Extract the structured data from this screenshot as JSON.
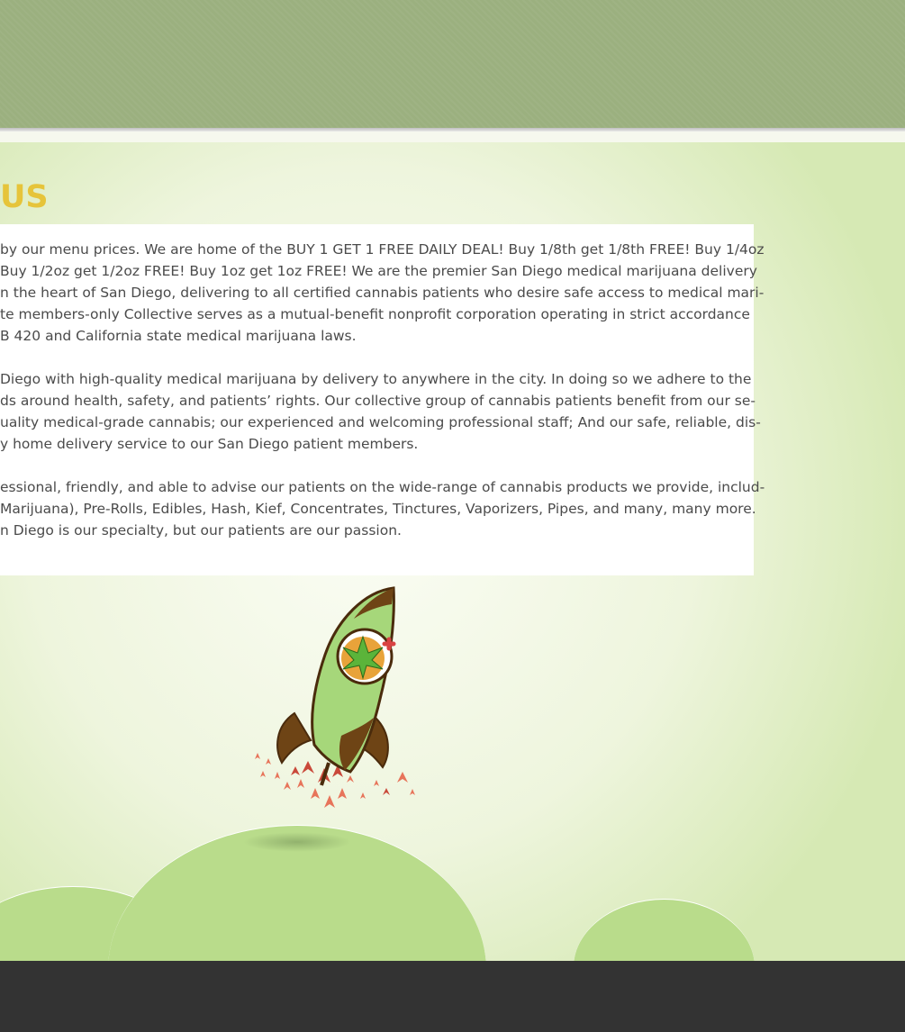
{
  "main": {
    "heading": "US",
    "paragraphs": [
      {
        "lines": [
          "by our menu prices. We are home of the BUY 1 GET 1 FREE DAILY DEAL! Buy 1/8th get 1/8th FREE! Buy 1/4oz",
          "Buy 1/2oz get 1/2oz FREE! Buy 1oz get 1oz FREE! We are the premier San Diego medical marijuana delivery",
          "n the heart of San Diego, delivering to all certified cannabis patients who desire safe access to medical mari-",
          "te members-only Collective serves as a mutual-benefit nonprofit corporation operating in strict accordance",
          "B 420 and California state medical marijuana laws."
        ]
      },
      {
        "lines": [
          "Diego with high-quality medical marijuana by delivery to anywhere in the city. In doing so we adhere to the",
          "ds around health, safety, and patients’ rights. Our collective group of cannabis patients benefit from our se-",
          "uality medical-grade cannabis; our experienced and welcoming professional staff; And our safe, reliable, dis-",
          "y home delivery service to our San Diego patient members."
        ]
      },
      {
        "lines": [
          "essional, friendly, and able to advise our patients on the wide-range of cannabis products we provide, includ-",
          "Marijuana), Pre-Rolls, Edibles, Hash, Kief, Concentrates, Tinctures, Vaporizers, Pipes, and many, many more.",
          "n Diego is our specialty, but our patients are our passion."
        ]
      }
    ]
  },
  "illustration": {
    "icon": "rocket-cannabis-leaf-icon"
  },
  "colors": {
    "header_green": "#9bb07f",
    "heading_yellow": "#e6c43a",
    "hill_green": "#b9dc8b",
    "footer_dark": "#333333"
  }
}
